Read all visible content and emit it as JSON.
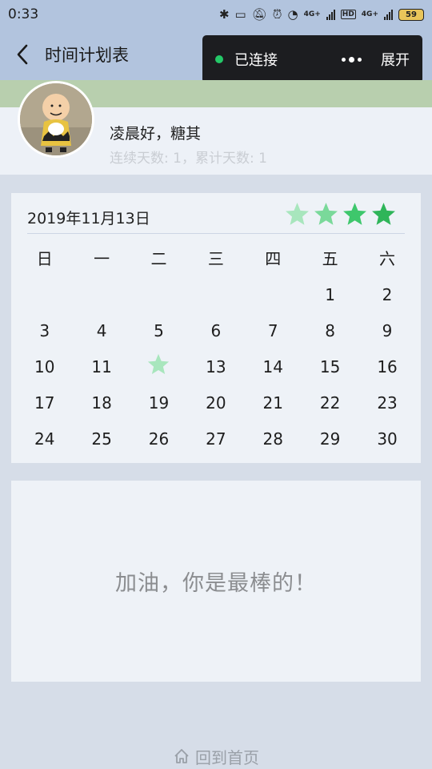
{
  "status_bar": {
    "time": "0:33",
    "net1": "4G+",
    "net2": "4G+",
    "hd": "HD",
    "battery": "59"
  },
  "nav": {
    "title": "时间计划表"
  },
  "popup": {
    "status": "已连接",
    "expand": "展开"
  },
  "profile": {
    "greeting": "凌晨好，糖其",
    "streak": "连续天数: 1，累计天数: 1"
  },
  "calendar": {
    "date": "2019年11月13日",
    "rating_stars": 4,
    "star_colors": [
      "#a8e6bd",
      "#7ad99a",
      "#3ec76c",
      "#2fb559"
    ],
    "weekdays": [
      "日",
      "一",
      "二",
      "三",
      "四",
      "五",
      "六"
    ],
    "weeks": [
      [
        "",
        "",
        "",
        "",
        "",
        "1",
        "2"
      ],
      [
        "3",
        "4",
        "5",
        "6",
        "7",
        "8",
        "9"
      ],
      [
        "10",
        "11",
        "★",
        "13",
        "14",
        "15",
        "16"
      ],
      [
        "17",
        "18",
        "19",
        "20",
        "21",
        "22",
        "23"
      ],
      [
        "24",
        "25",
        "26",
        "27",
        "28",
        "29",
        "30"
      ]
    ],
    "marked_day_color": "#a8e6bd"
  },
  "motivation": {
    "text": "加油，你是最棒的！"
  },
  "footer": {
    "home_label": "回到首页"
  }
}
